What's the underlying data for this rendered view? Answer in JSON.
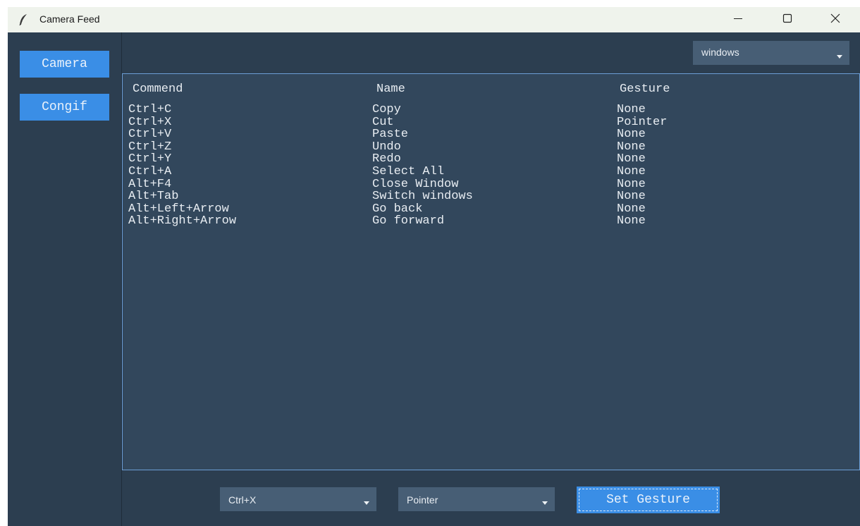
{
  "window": {
    "title": "Camera Feed"
  },
  "title_controls": {
    "minimize_icon": "minimize-icon",
    "maximize_icon": "maximize-icon",
    "close_icon": "close-icon"
  },
  "sidebar": {
    "items": [
      {
        "label": "Camera"
      },
      {
        "label": "Congif"
      }
    ]
  },
  "os_select": {
    "value": "windows"
  },
  "table": {
    "headers": [
      "Commend",
      "Name",
      "Gesture"
    ],
    "rows": [
      [
        "Ctrl+C",
        "Copy",
        "None"
      ],
      [
        "Ctrl+X",
        "Cut",
        "Pointer"
      ],
      [
        "Ctrl+V",
        "Paste",
        "None"
      ],
      [
        "Ctrl+Z",
        "Undo",
        "None"
      ],
      [
        "Ctrl+Y",
        "Redo",
        "None"
      ],
      [
        "Ctrl+A",
        "Select All",
        "None"
      ],
      [
        "Alt+F4",
        "Close Window",
        "None"
      ],
      [
        "Alt+Tab",
        "Switch windows",
        "None"
      ],
      [
        "Alt+Left+Arrow",
        "Go back",
        "None"
      ],
      [
        "Alt+Right+Arrow",
        "Go forward",
        "None"
      ]
    ]
  },
  "controls": {
    "command_value": "Ctrl+X",
    "gesture_value": "Pointer",
    "set_label": "Set Gesture"
  },
  "colors": {
    "window_bg": "#2c3e50",
    "list_bg": "#32475c",
    "accent": "#3a8ee6",
    "select_bg": "#475e75",
    "titlebar_bg": "#eff3ec"
  }
}
